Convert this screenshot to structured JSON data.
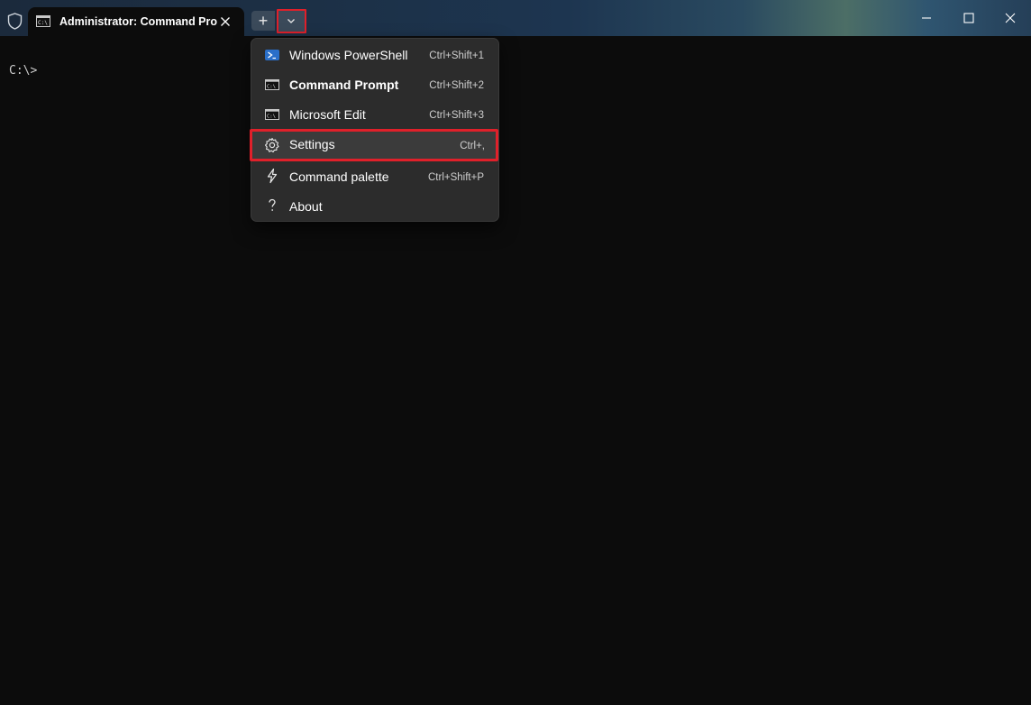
{
  "titlebar": {
    "tab_title": "Administrator: Command Pro",
    "new_tab_label": "+"
  },
  "terminal": {
    "prompt": "C:\\>"
  },
  "menu": {
    "items": [
      {
        "label": "Windows PowerShell",
        "shortcut": "Ctrl+Shift+1",
        "icon": "powershell-icon"
      },
      {
        "label": "Command Prompt",
        "shortcut": "Ctrl+Shift+2",
        "icon": "command-prompt-icon"
      },
      {
        "label": "Microsoft Edit",
        "shortcut": "Ctrl+Shift+3",
        "icon": "command-prompt-icon"
      },
      {
        "label": "Settings",
        "shortcut": "Ctrl+,",
        "icon": "gear-icon"
      },
      {
        "label": "Command palette",
        "shortcut": "Ctrl+Shift+P",
        "icon": "lightning-icon"
      },
      {
        "label": "About",
        "shortcut": "",
        "icon": "question-icon"
      }
    ]
  },
  "colors": {
    "highlight": "#e0202a",
    "terminal_bg": "#0c0c0c",
    "menu_bg": "#2c2c2c"
  }
}
